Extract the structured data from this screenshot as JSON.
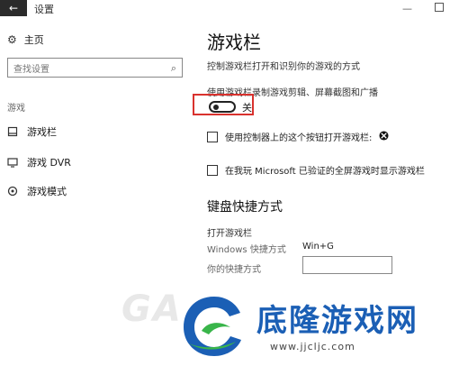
{
  "window": {
    "title": "设置",
    "back_glyph": "←",
    "minimize_glyph": "—"
  },
  "sidebar": {
    "home_label": "主页",
    "search_placeholder": "查找设置",
    "section_label": "游戏",
    "items": [
      {
        "label": "游戏栏",
        "icon": "game-bar-icon"
      },
      {
        "label": "游戏 DVR",
        "icon": "dvr-icon"
      },
      {
        "label": "游戏模式",
        "icon": "game-mode-icon"
      }
    ]
  },
  "main": {
    "title": "游戏栏",
    "description": "控制游戏栏打开和识别你的游戏的方式",
    "record_label": "使用游戏栏录制游戏剪辑、屏幕截图和广播",
    "toggle": {
      "state": "关",
      "on": false
    },
    "checkbox1_label": "使用控制器上的这个按钮打开游戏栏:",
    "checkbox2_label": "在我玩 Microsoft 已验证的全屏游戏时显示游戏栏",
    "keyboard_section_title": "键盘快捷方式",
    "open_game_bar_label": "打开游戏栏",
    "windows_shortcut_label": "Windows 快捷方式",
    "windows_shortcut_value": "Win+G",
    "your_shortcut_label": "你的快捷方式",
    "your_shortcut_value": ""
  },
  "watermark": {
    "letters": "GA",
    "brand": "底隆游戏网",
    "url": "www.jjcljc.com"
  },
  "colors": {
    "highlight": "#d9322e",
    "brand_blue": "#1b5fb5",
    "logo_green": "#39b54a"
  }
}
